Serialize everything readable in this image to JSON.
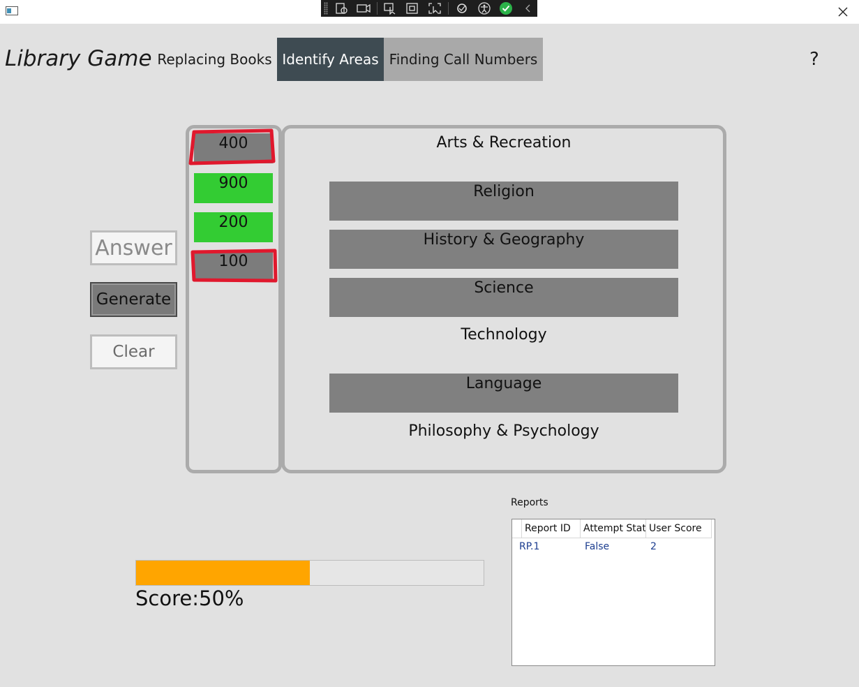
{
  "app": {
    "title": "Library Game",
    "tabs": [
      {
        "label": "Replacing Books"
      },
      {
        "label": "Identify Areas",
        "selected": true
      },
      {
        "label": "Finding Call Numbers"
      }
    ],
    "help_label": "?"
  },
  "controls": {
    "answer_label": "Answer",
    "generate_label": "Generate",
    "clear_label": "Clear"
  },
  "call_numbers": [
    {
      "value": "400",
      "state": "wrong"
    },
    {
      "value": "900",
      "state": "correct"
    },
    {
      "value": "200",
      "state": "correct"
    },
    {
      "value": "100",
      "state": "wrong"
    }
  ],
  "areas": [
    {
      "label": "Arts & Recreation",
      "filled": false
    },
    {
      "label": "Religion",
      "filled": true
    },
    {
      "label": "History & Geography",
      "filled": true
    },
    {
      "label": "Science",
      "filled": true
    },
    {
      "label": "Technology",
      "filled": false
    },
    {
      "label": "Language",
      "filled": true
    },
    {
      "label": "Philosophy & Psychology",
      "filled": false
    }
  ],
  "score": {
    "label": "Score:50%",
    "progress_fraction": 0.5
  },
  "reports": {
    "title": "Reports",
    "columns": [
      "Report ID",
      "Attempt Status",
      "User Score"
    ],
    "rows": [
      {
        "id": "RP.1",
        "attempt_status": "False",
        "score": "2"
      }
    ]
  },
  "colors": {
    "selected_tab": "#3e4b52",
    "correct_tile": "#33cc33",
    "wrong_outline": "#e0182d",
    "progress": "#ffa500"
  }
}
